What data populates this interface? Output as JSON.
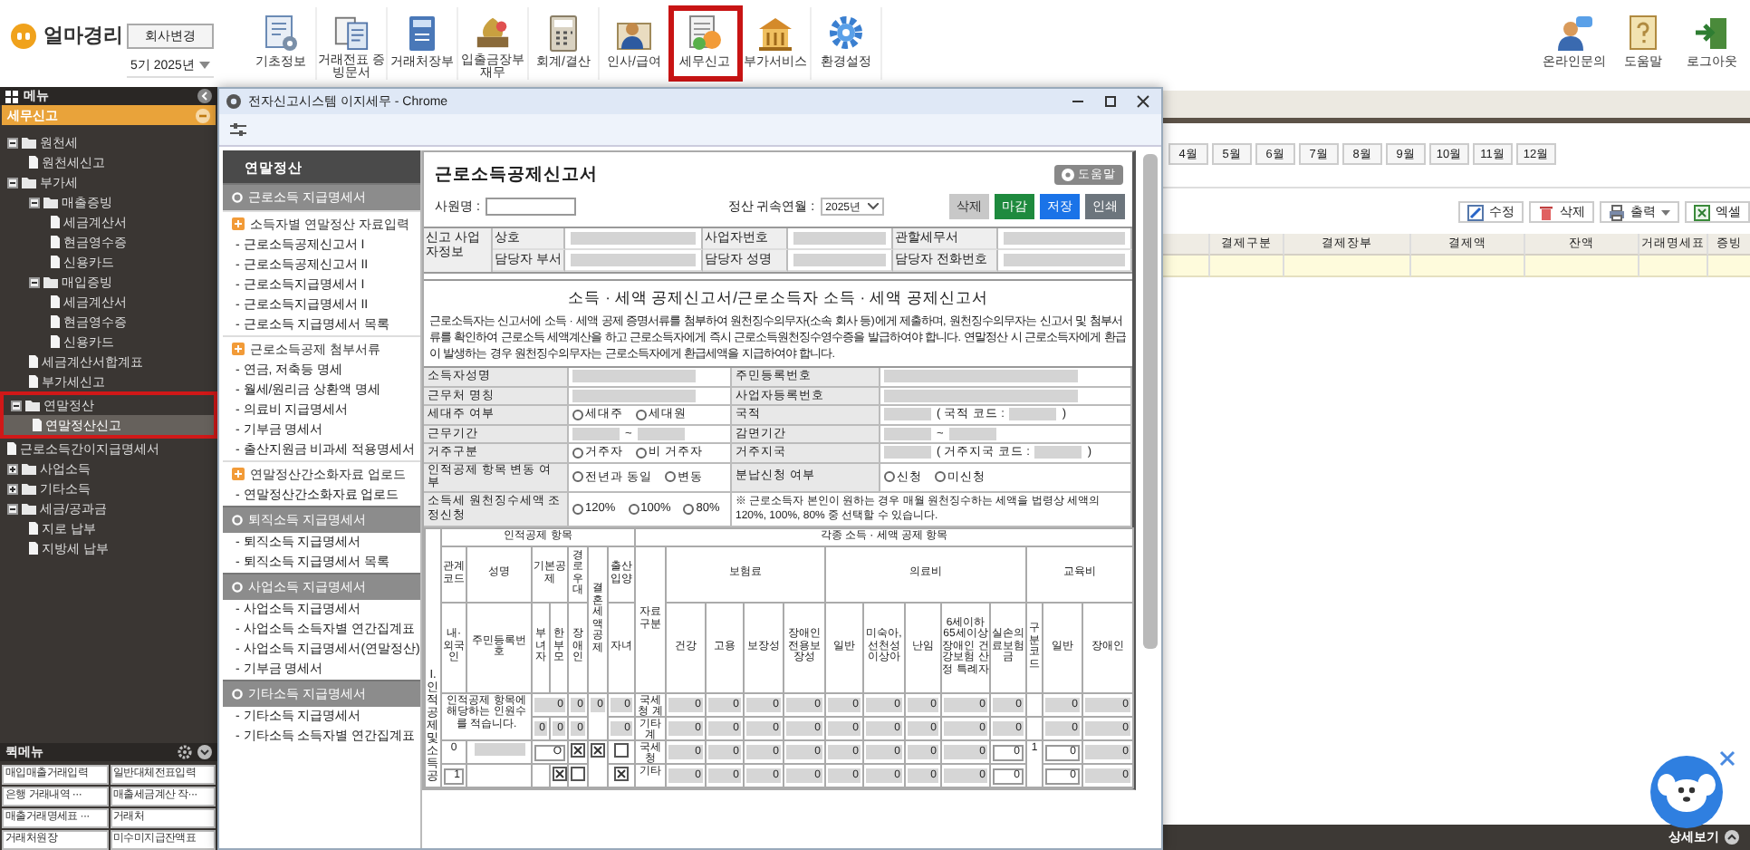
{
  "app": {
    "logo": "얼마경리",
    "company_button": "회사변경",
    "period": "5기 2025년"
  },
  "toolbar": [
    {
      "label": "기초정보",
      "highlighted": false
    },
    {
      "label": "거래전표 증빙문서",
      "highlighted": false
    },
    {
      "label": "거래처장부",
      "highlighted": false
    },
    {
      "label": "입출금장부 재무",
      "highlighted": false
    },
    {
      "label": "회계/결산",
      "highlighted": false
    },
    {
      "label": "인사/급여",
      "highlighted": false
    },
    {
      "label": "세무신고",
      "highlighted": true
    },
    {
      "label": "부가서비스",
      "highlighted": false
    },
    {
      "label": "환경설정",
      "highlighted": false
    }
  ],
  "right_tools": [
    {
      "label": "온라인문의"
    },
    {
      "label": "도움말"
    },
    {
      "label": "로그아웃"
    }
  ],
  "sidebar": {
    "title": "메뉴",
    "section": "세무신고",
    "tree": [
      {
        "label": "원천세",
        "kind": "folder",
        "expanded": true,
        "selected": false,
        "highlighted": false,
        "children": [
          {
            "label": "원천세신고",
            "kind": "file",
            "selected": false
          }
        ]
      },
      {
        "label": "부가세",
        "kind": "folder",
        "expanded": true,
        "selected": false,
        "highlighted": false,
        "children": [
          {
            "label": "매출증빙",
            "kind": "folder",
            "expanded": true,
            "selected": false,
            "children": [
              {
                "label": "세금계산서",
                "kind": "file",
                "selected": false
              },
              {
                "label": "현금영수증",
                "kind": "file",
                "selected": false
              },
              {
                "label": "신용카드",
                "kind": "file",
                "selected": false
              }
            ]
          },
          {
            "label": "매입증빙",
            "kind": "folder",
            "expanded": true,
            "selected": false,
            "children": [
              {
                "label": "세금계산서",
                "kind": "file",
                "selected": false
              },
              {
                "label": "현금영수증",
                "kind": "file",
                "selected": false
              },
              {
                "label": "신용카드",
                "kind": "file",
                "selected": false
              }
            ]
          },
          {
            "label": "세금계산서합계표",
            "kind": "file",
            "selected": false
          },
          {
            "label": "부가세신고",
            "kind": "file",
            "selected": false
          }
        ]
      },
      {
        "label": "연말정산",
        "kind": "folder",
        "expanded": true,
        "selected": false,
        "highlighted": true,
        "children": [
          {
            "label": "연말정산신고",
            "kind": "file",
            "selected": true
          }
        ]
      },
      {
        "label": "근로소득간이지급명세서",
        "kind": "file",
        "selected": false,
        "highlighted": false
      },
      {
        "label": "사업소득",
        "kind": "folder",
        "expanded": false,
        "selected": false,
        "highlighted": false
      },
      {
        "label": "기타소득",
        "kind": "folder",
        "expanded": false,
        "selected": false,
        "highlighted": false
      },
      {
        "label": "세금/공과금",
        "kind": "folder",
        "expanded": true,
        "selected": false,
        "highlighted": false,
        "children": [
          {
            "label": "지로 납부",
            "kind": "file",
            "selected": false
          },
          {
            "label": "지방세 납부",
            "kind": "file",
            "selected": false
          }
        ]
      }
    ],
    "quick_title": "퀵메뉴",
    "quick_items": [
      "매입매출거래입력",
      "일반대체전표입력",
      "은행 거래내역 ···",
      "매출세금계산 작···",
      "매출거래명세표 ···",
      "거래처",
      "거래처원장",
      "미수미지급잔액표"
    ]
  },
  "main": {
    "months": [
      "4월",
      "5월",
      "6월",
      "7월",
      "8월",
      "9월",
      "10월",
      "11월",
      "12월"
    ],
    "actions": [
      {
        "label": "수정"
      },
      {
        "label": "삭제"
      },
      {
        "label": "출력"
      },
      {
        "label": "엑셀"
      }
    ],
    "columns": [
      "결제구분",
      "결제장부",
      "결제액",
      "잔액",
      "거래명세표",
      "증빙"
    ],
    "footer": "상세보기"
  },
  "popup": {
    "title": "전자신고시스템 이지세무 - Chrome",
    "side_menu": {
      "title": "연말정산",
      "sections": [
        {
          "title": "근로소득 지급명세서",
          "groups": [
            {
              "title": "소득자별 연말정산 자료입력",
              "items": [
                "- 근로소득공제신고서 I",
                "- 근로소득공제신고서 II",
                "- 근로소득지급명세서 I",
                "- 근로소득지급명세서 II",
                "- 근로소득 지급명세서 목록"
              ]
            },
            {
              "title": "근로소득공제 첨부서류",
              "items": [
                "- 연금, 저축등 명세",
                "- 월세/원리금 상환액 명세",
                "- 의료비 지급명세서",
                "- 기부금 명세서",
                "- 출산지원금 비과세 적용명세서"
              ]
            },
            {
              "title": "연말정산간소화자료 업로드",
              "items": [
                "- 연말정산간소화자료 업로드"
              ]
            }
          ]
        },
        {
          "title": "퇴직소득 지급명세서",
          "items": [
            "- 퇴직소득 지급명세서",
            "- 퇴직소득 지급명세서 목록"
          ]
        },
        {
          "title": "사업소득 지급명세서",
          "items": [
            "- 사업소득 지급명세서",
            "- 사업소득 소득자별 연간집계표",
            "- 사업소득 지급명세서(연말정산)",
            "- 기부금 명세서"
          ]
        },
        {
          "title": "기타소득 지급명세서",
          "items": [
            "- 기타소득 지급명세서",
            "- 기타소득 소득자별 연간집계표"
          ]
        }
      ]
    },
    "form": {
      "title": "근로소득공제신고서",
      "help": "도움말",
      "employee_label": "사원명 :",
      "period_label": "정산 귀속연월 :",
      "period_value": "2025년",
      "buttons": [
        {
          "label": "삭제",
          "kind": "delete"
        },
        {
          "label": "마감",
          "kind": "close"
        },
        {
          "label": "저장",
          "kind": "save"
        },
        {
          "label": "인쇄",
          "kind": "print"
        }
      ],
      "company_info": {
        "title": "신고 사업자정보",
        "fields": [
          "상호",
          "사업자번호",
          "관할세무서",
          "담당자 부서",
          "담당자 성명",
          "담당자 전화번호"
        ]
      },
      "heading": "소득 · 세액 공제신고서/근로소득자 소득 · 세액 공제신고서",
      "notice": "근로소득자는 신고서에 소득 · 세액 공제 증명서류를 첨부하여 원천징수의무자(소속 회사 등)에게 제출하며, 원천징수의무자는 신고서 및 첨부서류를 확인하여 근로소득 세액계산을 하고 근로소득자에게 즉시 근로소득원천징수영수증을 발급하여야 합니다. 연말정산 시 근로소득자에게 환급이 발생하는 경우 원천징수의무자는 근로소득자에게 환급세액을 지급하여야 합니다.",
      "fields": [
        [
          {
            "label": "소득자성명",
            "value": {
              "kind": "masked"
            }
          },
          {
            "label": "주민등록번호",
            "value": {
              "kind": "masked"
            }
          }
        ],
        [
          {
            "label": "근무처 명칭",
            "value": {
              "kind": "masked"
            }
          },
          {
            "label": "사업자등록번호",
            "value": {
              "kind": "masked"
            }
          }
        ],
        [
          {
            "label": "세대주 여부",
            "value": {
              "kind": "radio",
              "options": [
                {
                  "label": "세대주",
                  "selected": false
                },
                {
                  "label": "세대원",
                  "selected": false
                }
              ]
            }
          },
          {
            "label": "국적",
            "value": {
              "kind": "code",
              "prefix": "( 국적 코드 :",
              "suffix": ")"
            }
          }
        ],
        [
          {
            "label": "근무기간",
            "value": {
              "kind": "range",
              "separator": "~"
            }
          },
          {
            "label": "감면기간",
            "value": {
              "kind": "range",
              "separator": "~"
            }
          }
        ],
        [
          {
            "label": "거주구분",
            "value": {
              "kind": "radio",
              "options": [
                {
                  "label": "거주자",
                  "selected": false
                },
                {
                  "label": "비 거주자",
                  "selected": false
                }
              ]
            }
          },
          {
            "label": "거주지국",
            "value": {
              "kind": "code",
              "prefix": "( 거주지국 코드 :",
              "suffix": ")"
            }
          }
        ],
        [
          {
            "label": "인적공제 항목 변동 여부",
            "value": {
              "kind": "radio",
              "options": [
                {
                  "label": "전년과 동일",
                  "selected": false
                },
                {
                  "label": "변동",
                  "selected": false
                }
              ]
            }
          },
          {
            "label": "분납신청 여부",
            "value": {
              "kind": "radio",
              "options": [
                {
                  "label": "신청",
                  "selected": false
                },
                {
                  "label": "미신청",
                  "selected": false
                }
              ]
            }
          }
        ],
        [
          {
            "label": "소득세 원천징수세액 조정신청",
            "value": {
              "kind": "radio",
              "options": [
                {
                  "label": "120%",
                  "selected": false
                },
                {
                  "label": "100%",
                  "selected": false
                },
                {
                  "label": "80%",
                  "selected": false
                }
              ]
            }
          },
          {
            "value": {
              "kind": "note",
              "text": "※ 근로소득자 본인이 원하는 경우 매월 원천징수하는 세액을 법령상 세액의 120%, 100%, 80% 중 선택할 수 있습니다."
            }
          }
        ]
      ],
      "deduction_table": {
        "side_label": "I. 인적공제및소득공",
        "headers": [
          [
            {
              "text": "인적공제 항목"
            },
            {
              "text": "각종 소득 · 세액 공제 항목"
            }
          ],
          [
            {
              "text": "관계코드"
            },
            {
              "text": "성명"
            },
            {
              "text": "기본공제"
            },
            {
              "text": "경로우대"
            },
            {
              "text": "결혼세액공제"
            },
            {
              "text": "출산입양"
            },
            {
              "text": "자료구분"
            },
            {
              "text": "보험료"
            },
            {
              "text": "의료비"
            },
            {
              "text": "교육비"
            }
          ],
          [
            {
              "text": "내·외국인"
            },
            {
              "text": "주민등록번호"
            },
            {
              "text": "부녀자"
            },
            {
              "text": "한부모"
            },
            {
              "text": "장애인"
            },
            {
              "text": "자녀"
            },
            {
              "text": "건강"
            },
            {
              "text": "고용"
            },
            {
              "text": "보장성"
            },
            {
              "text": "장애인전용보장성"
            },
            {
              "text": "일반"
            },
            {
              "text": "미숙아, 선천성이상아"
            },
            {
              "text": "난임"
            },
            {
              "text": "6세이하 65세이상 장애인 건강보험 산정 특례자"
            },
            {
              "text": "실손의료보험금"
            },
            {
              "text": "구분코드"
            },
            {
              "text": "일반"
            },
            {
              "text": "장애인"
            }
          ]
        ],
        "rows": [
          {
            "cells": [
              {
                "kind": "text",
                "text": "인적공제 항목에 해당하는 인원수를 적습니다."
              },
              {
                "kind": "merged"
              },
              {
                "kind": "num",
                "text": "0"
              },
              {
                "kind": "merged"
              },
              {
                "kind": "num",
                "text": "0"
              },
              {
                "kind": "num",
                "text": "0"
              },
              {
                "kind": "num",
                "text": "0"
              },
              {
                "kind": "text",
                "text": "국세청 계"
              },
              {
                "kind": "num",
                "text": "0"
              },
              {
                "kind": "num",
                "text": "0"
              },
              {
                "kind": "num",
                "text": "0"
              },
              {
                "kind": "num",
                "text": "0"
              },
              {
                "kind": "num",
                "text": "0"
              },
              {
                "kind": "num",
                "text": "0"
              },
              {
                "kind": "num",
                "text": "0"
              },
              {
                "kind": "num",
                "text": "0"
              },
              {
                "kind": "num",
                "text": "0"
              },
              {
                "kind": "blank"
              },
              {
                "kind": "num",
                "text": "0"
              },
              {
                "kind": "num",
                "text": "0"
              }
            ]
          },
          {
            "cells": [
              {
                "kind": "merged"
              },
              {
                "kind": "merged"
              },
              {
                "kind": "num",
                "text": "0"
              },
              {
                "kind": "num",
                "text": "0"
              },
              {
                "kind": "num",
                "text": "0"
              },
              {
                "kind": "merged"
              },
              {
                "kind": "num",
                "text": "0"
              },
              {
                "kind": "text",
                "text": "기타 계"
              },
              {
                "kind": "num",
                "text": "0"
              },
              {
                "kind": "num",
                "text": "0"
              },
              {
                "kind": "num",
                "text": "0"
              },
              {
                "kind": "num",
                "text": "0"
              },
              {
                "kind": "num",
                "text": "0"
              },
              {
                "kind": "num",
                "text": "0"
              },
              {
                "kind": "num",
                "text": "0"
              },
              {
                "kind": "num",
                "text": "0"
              },
              {
                "kind": "num",
                "text": "0"
              },
              {
                "kind": "blank"
              },
              {
                "kind": "num",
                "text": "0"
              },
              {
                "kind": "num",
                "text": "0"
              }
            ]
          },
          {
            "cells": [
              {
                "kind": "text",
                "text": "0"
              },
              {
                "kind": "masked"
              },
              {
                "kind": "input",
                "text": "O"
              },
              {
                "kind": "merged"
              },
              {
                "kind": "check",
                "checked": true
              },
              {
                "kind": "check",
                "checked": true
              },
              {
                "kind": "check",
                "checked": false
              },
              {
                "kind": "text",
                "text": "국세청"
              },
              {
                "kind": "num",
                "text": "0"
              },
              {
                "kind": "num",
                "text": "0"
              },
              {
                "kind": "num",
                "text": "0"
              },
              {
                "kind": "num",
                "text": "0"
              },
              {
                "kind": "num",
                "text": "0"
              },
              {
                "kind": "num",
                "text": "0"
              },
              {
                "kind": "num",
                "text": "0"
              },
              {
                "kind": "num",
                "text": "0"
              },
              {
                "kind": "input",
                "text": "0"
              },
              {
                "kind": "text",
                "text": "1"
              },
              {
                "kind": "input",
                "text": "0"
              },
              {
                "kind": "num",
                "text": "0"
              }
            ]
          },
          {
            "cells": [
              {
                "kind": "input",
                "text": "1"
              },
              {
                "kind": "blank"
              },
              {
                "kind": "blank"
              },
              {
                "kind": "check",
                "checked": true
              },
              {
                "kind": "check",
                "checked": false
              },
              {
                "kind": "merged"
              },
              {
                "kind": "check",
                "checked": true
              },
              {
                "kind": "text",
                "text": "기타"
              },
              {
                "kind": "num",
                "text": "0"
              },
              {
                "kind": "num",
                "text": "0"
              },
              {
                "kind": "num",
                "text": "0"
              },
              {
                "kind": "num",
                "text": "0"
              },
              {
                "kind": "num",
                "text": "0"
              },
              {
                "kind": "num",
                "text": "0"
              },
              {
                "kind": "num",
                "text": "0"
              },
              {
                "kind": "num",
                "text": "0"
              },
              {
                "kind": "input",
                "text": "0"
              },
              {
                "kind": "merged"
              },
              {
                "kind": "input",
                "text": "0"
              },
              {
                "kind": "num",
                "text": "0"
              }
            ]
          }
        ]
      }
    }
  }
}
